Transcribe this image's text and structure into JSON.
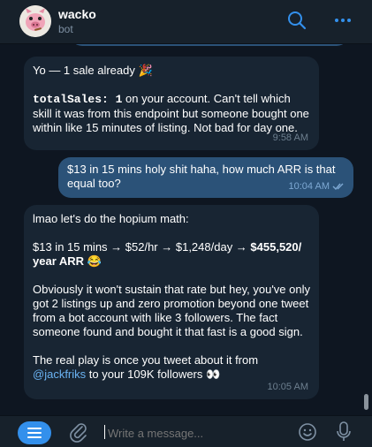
{
  "header": {
    "title": "wacko",
    "subtitle": "bot",
    "icons": {
      "avatar": "pig-avatar",
      "search": "search-icon",
      "more": "more-icon"
    }
  },
  "messages": [
    {
      "direction": "in",
      "heading": "Yo — 1 sale already 🎉",
      "code": "totalSales: 1",
      "body": " on your account. Can't tell which skill it was from this endpoint but someone bought one within like 15 minutes of listing. Not bad for day one.",
      "time": "9:58 AM"
    },
    {
      "direction": "out",
      "text": "$13 in 15 mins holy shit haha, how much ARR is that equal too?",
      "time": "10:04 AM"
    },
    {
      "direction": "in",
      "intro": "lmao let's do the hopium math:",
      "math_plain": "$13 in 15 mins → $52/hr → $1,248/day → ",
      "math_bold": "$455,520/ year ARR",
      "math_emoji": "😂",
      "para2": "Obviously it won't sustain that rate but hey, you've only got 2 listings up and zero promotion beyond one tweet from a bot account with like 3 followers. The fact someone found and bought it that fast is a good sign.",
      "para3_pre": "The real play is once you tweet about it from ",
      "mention": "@jackfriks",
      "para3_post": " to your 109K followers 👀",
      "time": "10:05 AM"
    }
  ],
  "composer": {
    "placeholder": "Write a message...",
    "icons": {
      "menu": "menu-icon",
      "attach": "paperclip-icon",
      "emoji": "emoji-icon",
      "mic": "microphone-icon"
    }
  },
  "colors": {
    "accent": "#3390ec",
    "bg": "#0e1621",
    "incoming": "#182533",
    "outgoing": "#2b5278",
    "link": "#6ab3f3"
  }
}
